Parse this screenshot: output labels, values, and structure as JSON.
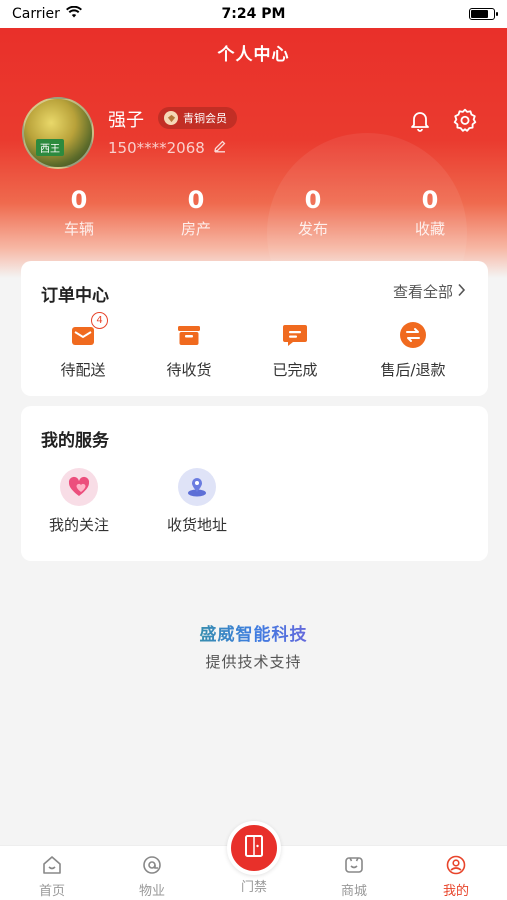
{
  "status_bar": {
    "carrier": "Carrier",
    "time": "7:24 PM"
  },
  "header": {
    "title": "个人中心"
  },
  "profile": {
    "name": "强子",
    "member_level": "青铜会员",
    "phone": "150****2068",
    "avatar_text": "西王"
  },
  "stats": [
    {
      "value": "0",
      "label": "车辆"
    },
    {
      "value": "0",
      "label": "房产"
    },
    {
      "value": "0",
      "label": "发布"
    },
    {
      "value": "0",
      "label": "收藏"
    }
  ],
  "orders": {
    "title": "订单中心",
    "view_all": "查看全部",
    "items": [
      {
        "label": "待配送",
        "icon": "box-icon",
        "badge": "4"
      },
      {
        "label": "待收货",
        "icon": "package-icon"
      },
      {
        "label": "已完成",
        "icon": "chat-icon"
      },
      {
        "label": "售后/退款",
        "icon": "exchange-icon"
      }
    ]
  },
  "services": {
    "title": "我的服务",
    "items": [
      {
        "label": "我的关注",
        "icon": "heart-icon"
      },
      {
        "label": "收货地址",
        "icon": "location-icon"
      }
    ]
  },
  "brand": {
    "name": "盛威智能科技",
    "subtitle": "提供技术支持"
  },
  "tabs": [
    {
      "label": "首页",
      "icon": "home-icon"
    },
    {
      "label": "物业",
      "icon": "property-icon"
    },
    {
      "label": "门禁",
      "icon": "door-icon"
    },
    {
      "label": "商城",
      "icon": "shop-icon"
    },
    {
      "label": "我的",
      "icon": "profile-icon",
      "active": true
    }
  ],
  "colors": {
    "primary": "#e8302a",
    "accent": "#f06a1f",
    "service_pink": "#f5dbe2",
    "service_blue": "#d8def7"
  }
}
